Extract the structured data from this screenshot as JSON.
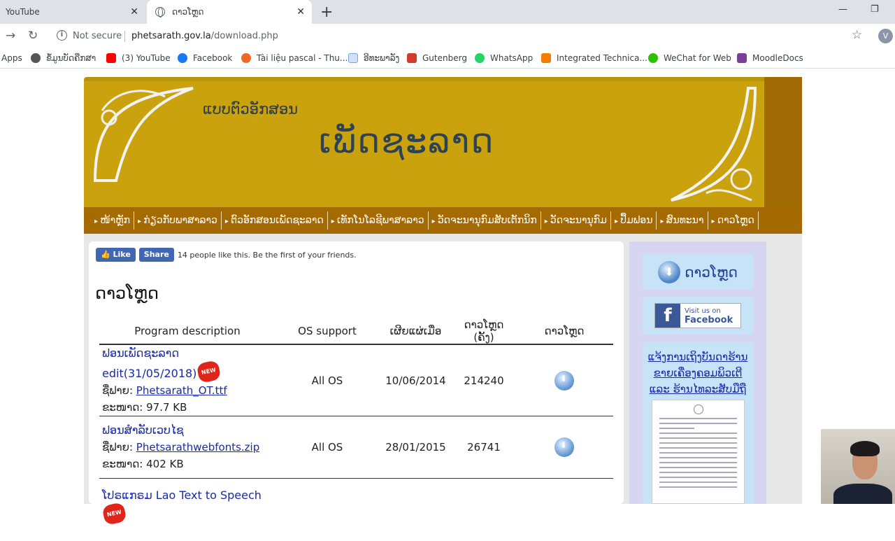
{
  "browser": {
    "tabs": [
      {
        "title": "YouTube"
      },
      {
        "title": "ດາວໂຫຼດ"
      }
    ],
    "address": {
      "status": "Not secure",
      "host": "phetsarath.gov.la",
      "path": "/download.php"
    },
    "profile_initial": "V",
    "bookmarks": [
      {
        "label": "Apps",
        "color": "#5f6368"
      },
      {
        "label": "ຂໍ້ມູນບັດຄືກສາ",
        "color": "#555555"
      },
      {
        "label": "(3) YouTube",
        "color": "#ff0000"
      },
      {
        "label": "Facebook",
        "color": "#1877f2"
      },
      {
        "label": "Tài liệu pascal - Thu...",
        "color": "#f26722"
      },
      {
        "label": "ອີທະພາລັງ",
        "color": "#7aa3e0"
      },
      {
        "label": "Gutenberg",
        "color": "#d33b2c"
      },
      {
        "label": "WhatsApp",
        "color": "#25d366"
      },
      {
        "label": "Integrated Technica...",
        "color": "#f57c00"
      },
      {
        "label": "WeChat for Web",
        "color": "#2dc100"
      },
      {
        "label": "MoodleDocs",
        "color": "#7b3f99"
      }
    ]
  },
  "site": {
    "banner_subtitle": "ແບບຕົວອັກສອນ",
    "banner_title": "ເພັດຊະລາດ",
    "menu": [
      "ໜ້າຫຼັກ",
      "ກ່ຽວກັບພາສາລາວ",
      "ຕົວອັກສອນເພັດຊະລາດ",
      "ເທັກໂນໂລຊີພາສາລາວ",
      "ວັດຈະນານຸກົມສັບເຕັກນິກ",
      "ວັດຈະນານຸກົມ",
      "ປຶ້ມຟອນ",
      "ສົນທະນາ",
      "ດາວໂຫຼດ"
    ],
    "facebook": {
      "like": "Like",
      "share": "Share",
      "text": "14 people like this. Be the first of your friends."
    },
    "heading": "ດາວໂຫຼດ",
    "table": {
      "headers": [
        "Program description",
        "OS support",
        "ເຜີຍແຜ່ເມື່ອ",
        "ດາວໂຫຼດ (ຄັ້ງ)",
        "ດາວໂຫຼດ"
      ],
      "rows": [
        {
          "name": "ຟອນເພັດຊະລາດ edit(31/05/2018)",
          "badge": "NEW",
          "file_label": "ຊື່ຟາຍ:",
          "file": "Phetsarath_OT.ttf",
          "size_label": "ຂະໜາດ:",
          "size": "97.7 KB",
          "os": "All OS",
          "date": "10/06/2014",
          "count": "214240"
        },
        {
          "name": "ຟອນສຳລັບເວບໄຊ",
          "badge": "",
          "file_label": "ຊື່ຟາຍ:",
          "file": "Phetsarathwebfonts.zip",
          "size_label": "ຂະໜາດ:",
          "size": "402 KB",
          "os": "All OS",
          "date": "28/01/2015",
          "count": "26741"
        },
        {
          "name": "ໂປຣແກຣມ Lao Text to Speech",
          "badge": "NEW",
          "file_label": "",
          "file": "",
          "size_label": "",
          "size": "",
          "os": "",
          "date": "",
          "count": ""
        }
      ]
    },
    "sidebar": {
      "download_label": "ດາວໂຫຼດ",
      "fb_visit": "Visit us on",
      "fb_name": "Facebook",
      "notice": "ແຈ້ງການເຖິງບັນດາຮ້ານຂາຍເຄື່ອງຄອມພິວເຕີ ແລະ ຮ້ານໄທລະສັບມືຖື"
    }
  }
}
